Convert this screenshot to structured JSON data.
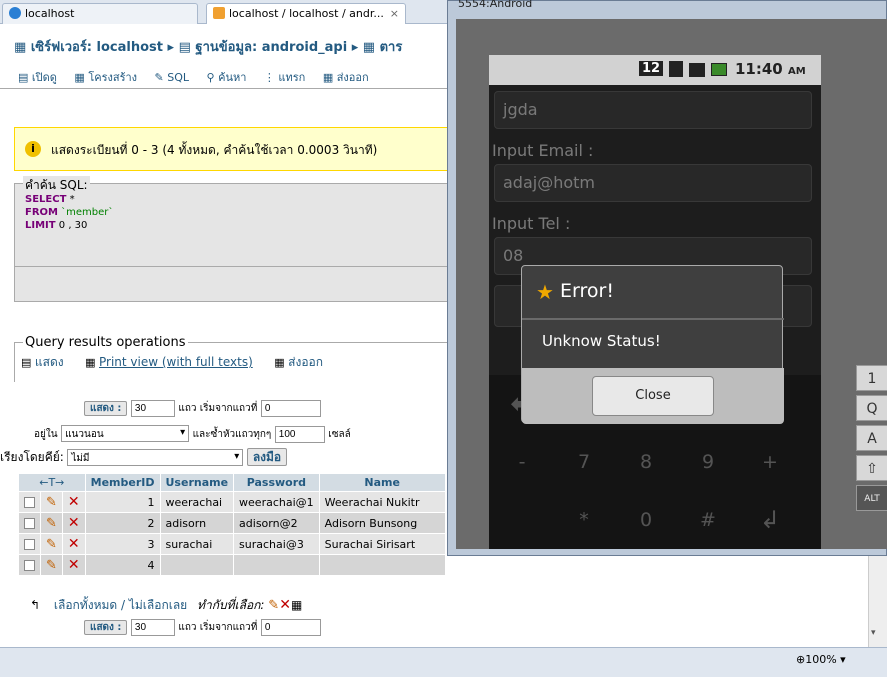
{
  "browser": {
    "tabs": [
      {
        "title": "localhost"
      },
      {
        "title": "localhost / localhost / andr..."
      }
    ],
    "zoom": "100%",
    "close_glyph": "×"
  },
  "pma": {
    "breadcrumb": {
      "server_label": "เซิร์ฟเวอร์: localhost",
      "db_label": "ฐานข้อมูล: android_api",
      "table_label": "ตาร"
    },
    "tabs": [
      "เปิดดู",
      "โครงสร้าง",
      "SQL",
      "ค้นหา",
      "แทรก",
      "ส่งออก"
    ],
    "notice": "แสดงระเบียนที่ 0 - 3 (4 ทั้งหมด, คำค้นใช้เวลา 0.0003 วินาที)",
    "sql": {
      "legend": "คำค้น SQL:",
      "line1_kw": "SELECT",
      "line1_rest": " *",
      "line2_kw": "FROM",
      "line2_rest": " `member`",
      "line3_kw": "LIMIT",
      "line3_rest": " 0 , 30"
    },
    "ops": {
      "legend": "Query results operations",
      "show": "แสดง",
      "print": "Print view (with full texts)",
      "export": "ส่งออก"
    },
    "nav": {
      "show_btn": "แสดง :",
      "rows": "30",
      "rows_label": "แถว เริ่มจากแถวที่",
      "start": "0",
      "mode_label": "อยู่ใน",
      "mode": "แนวนอน",
      "repeat_label": "และซ้ำหัวแถวทุกๆ",
      "repeat": "100",
      "cells_label": "เซลล์",
      "sort_label": "เรียงโดยคีย์:",
      "sort_value": "ไม่มี",
      "go_btn": "ลงมือ"
    },
    "table": {
      "nav_arrows": "←T→",
      "headers": [
        "MemberID",
        "Username",
        "Password",
        "Name"
      ],
      "rows": [
        {
          "id": "1",
          "user": "weerachai",
          "pass": "weerachai@1",
          "name": "Weerachai Nukitr"
        },
        {
          "id": "2",
          "user": "adisorn",
          "pass": "adisorn@2",
          "name": "Adisorn Bunsong"
        },
        {
          "id": "3",
          "user": "surachai",
          "pass": "surachai@3",
          "name": "Surachai Sirisart"
        },
        {
          "id": "4",
          "user": "",
          "pass": "",
          "name": ""
        }
      ]
    },
    "bottom": {
      "check_all": "เลือกทั้งหมด / ไม่เลือกเลย",
      "with_selected": "ทำกับที่เลือก:",
      "show_btn": "แสดง :",
      "rows": "30",
      "rows_label": "แถว เริ่มจากแถวที่",
      "start": "0"
    }
  },
  "emulator": {
    "title": "5554:Android",
    "status": {
      "badge": "12",
      "time": "11:40",
      "ampm": "AM"
    },
    "fields": [
      {
        "value": "jgda"
      },
      {
        "label": "Input Email :",
        "value": "adaj@hotm"
      },
      {
        "label": "Input Tel :",
        "value": "08"
      }
    ],
    "dialog": {
      "title": "Error!",
      "message": "Unknow Status!",
      "close": "Close"
    },
    "keys": [
      [
        "",
        "4",
        "5",
        "6",
        ""
      ],
      [
        "-",
        "7",
        "8",
        "9",
        "+"
      ],
      [
        "",
        "*",
        "0",
        "#",
        ""
      ]
    ],
    "side_keys": [
      "1",
      "Q",
      "A",
      "",
      "ALT"
    ]
  }
}
